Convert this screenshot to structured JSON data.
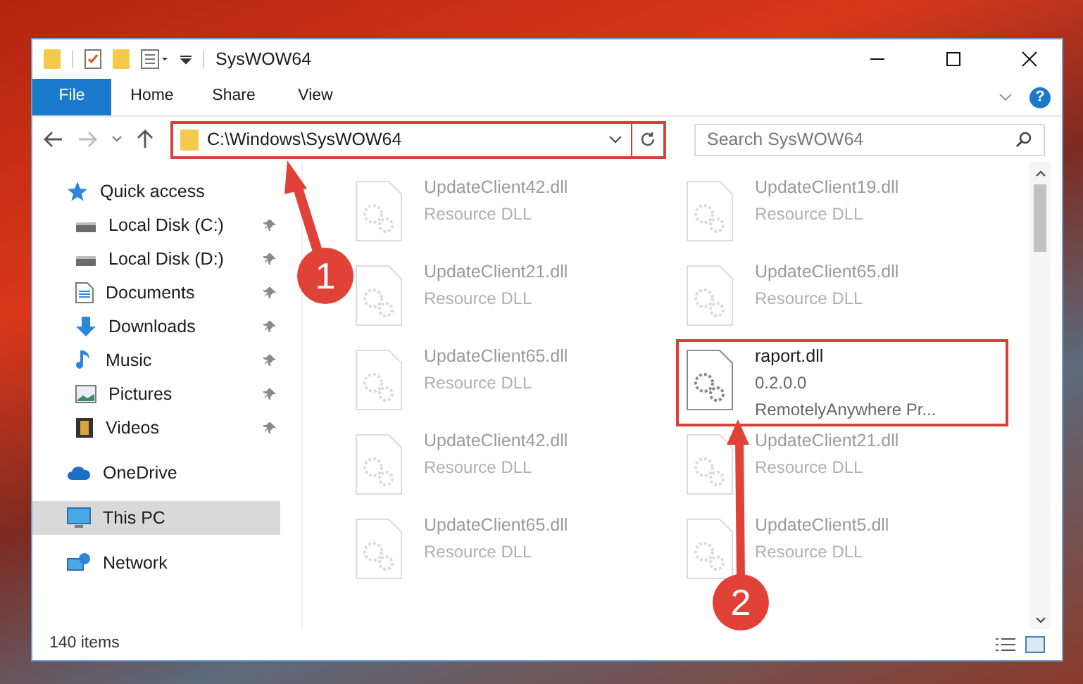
{
  "window": {
    "title": "SysWOW64"
  },
  "ribbon": {
    "tabs": [
      {
        "label": "File",
        "selected": true
      },
      {
        "label": "Home",
        "selected": false
      },
      {
        "label": "Share",
        "selected": false
      },
      {
        "label": "View",
        "selected": false
      }
    ],
    "help": "?"
  },
  "address": {
    "path": "C:\\Windows\\SysWOW64",
    "highlighted": true
  },
  "search": {
    "placeholder": "Search SysWOW64"
  },
  "sidebar": {
    "items": [
      {
        "label": "Quick access",
        "kind": "star",
        "pinned": false,
        "selected": false,
        "children": [
          {
            "label": "Local Disk (C:)",
            "kind": "disk",
            "pinned": true,
            "selected": false
          },
          {
            "label": "Local Disk (D:)",
            "kind": "disk",
            "pinned": true,
            "selected": false
          },
          {
            "label": "Documents",
            "kind": "document",
            "pinned": true,
            "selected": false
          },
          {
            "label": "Downloads",
            "kind": "download",
            "pinned": true,
            "selected": false
          },
          {
            "label": "Music",
            "kind": "music",
            "pinned": true,
            "selected": false
          },
          {
            "label": "Pictures",
            "kind": "picture",
            "pinned": true,
            "selected": false
          },
          {
            "label": "Videos",
            "kind": "video",
            "pinned": true,
            "selected": false
          }
        ]
      },
      {
        "label": "OneDrive",
        "kind": "cloud",
        "pinned": false,
        "selected": false
      },
      {
        "label": "This PC",
        "kind": "computer",
        "pinned": false,
        "selected": true
      },
      {
        "label": "Network",
        "kind": "network",
        "pinned": false,
        "selected": false
      }
    ]
  },
  "files": [
    {
      "name": "UpdateClient42.dll",
      "lines": [
        "Resource DLL"
      ],
      "highlighted": false
    },
    {
      "name": "UpdateClient19.dll",
      "lines": [
        "Resource DLL"
      ],
      "highlighted": false
    },
    {
      "name": "UpdateClient21.dll",
      "lines": [
        "Resource DLL"
      ],
      "highlighted": false
    },
    {
      "name": "UpdateClient65.dll",
      "lines": [
        "Resource DLL"
      ],
      "highlighted": false
    },
    {
      "name": "UpdateClient65.dll",
      "lines": [
        "Resource DLL"
      ],
      "highlighted": false
    },
    {
      "name": "raport.dll",
      "lines": [
        "0.2.0.0",
        "RemotelyAnywhere Pr..."
      ],
      "highlighted": true
    },
    {
      "name": "UpdateClient42.dll",
      "lines": [
        "Resource DLL"
      ],
      "highlighted": false
    },
    {
      "name": "UpdateClient21.dll",
      "lines": [
        "Resource DLL"
      ],
      "highlighted": false
    },
    {
      "name": "UpdateClient65.dll",
      "lines": [
        "Resource DLL"
      ],
      "highlighted": false
    },
    {
      "name": "UpdateClient5.dll",
      "lines": [
        "Resource DLL"
      ],
      "highlighted": false
    }
  ],
  "status_bar": {
    "count": "140 items"
  },
  "callouts": [
    {
      "number": "1"
    },
    {
      "number": "2"
    }
  ]
}
